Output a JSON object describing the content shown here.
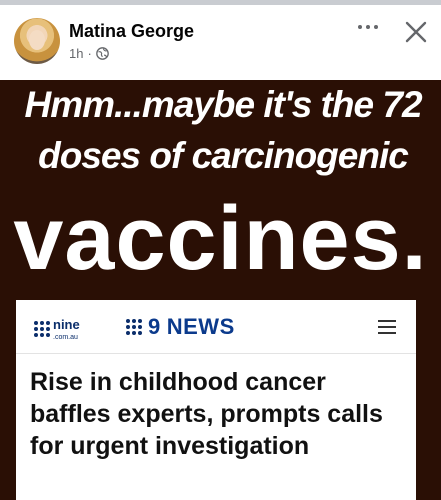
{
  "post": {
    "author": "Matina George",
    "time": "1h",
    "separator": "·",
    "privacy_icon": "globe-icon",
    "more_icon": "more-horizontal-icon",
    "close_icon": "close-icon"
  },
  "image": {
    "line1": "Hmm...maybe it's the 72",
    "line2": "doses of carcinogenic",
    "big_word": "vaccines.",
    "card": {
      "logo_left": "nine",
      "logo_left_sub": ".com.au",
      "logo_right": "NEWS",
      "logo_right_prefix": "9",
      "headline": "Rise in childhood cancer baffles experts, prompts calls for urgent investigation"
    }
  },
  "colors": {
    "image_bg": "#2a0f05",
    "brand_blue": "#0b3a8c"
  }
}
